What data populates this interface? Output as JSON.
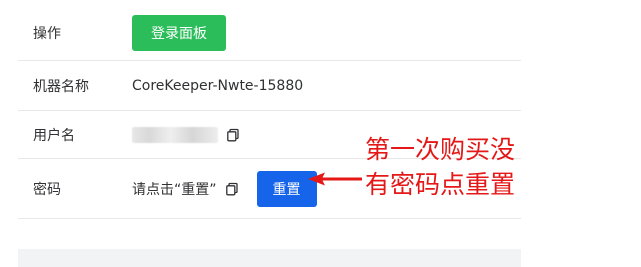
{
  "rows": {
    "action": {
      "label": "操作",
      "button_label": "登录面板"
    },
    "machine_name": {
      "label": "机器名称",
      "value": "CoreKeeper-Nwte-15880"
    },
    "username": {
      "label": "用户名"
    },
    "password": {
      "label": "密码",
      "hint": "请点击“重置”",
      "button_label": "重置"
    }
  },
  "annotation": {
    "text": "第一次购买没有密码点重置",
    "color": "#e51818"
  },
  "icons": {
    "copy": "copy-icon",
    "arrow": "arrow-left-icon"
  },
  "colors": {
    "login_button": "#2bbd5a",
    "reset_button": "#1664ea",
    "divider": "#e8e8e8",
    "bottom_band": "#f2f3f5"
  }
}
